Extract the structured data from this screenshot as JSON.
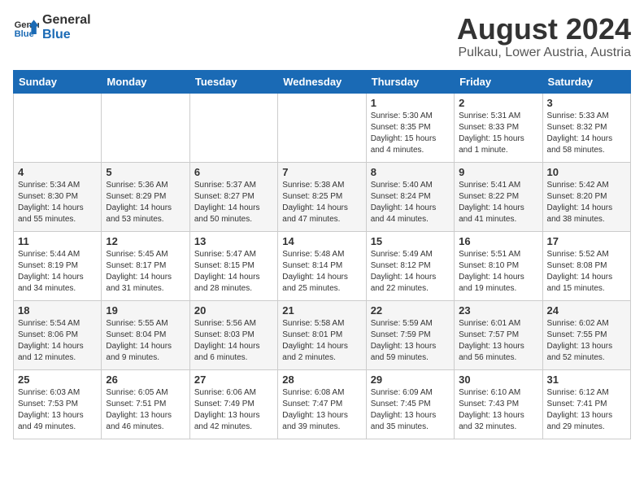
{
  "logo": {
    "line1": "General",
    "line2": "Blue"
  },
  "title": "August 2024",
  "subtitle": "Pulkau, Lower Austria, Austria",
  "days_of_week": [
    "Sunday",
    "Monday",
    "Tuesday",
    "Wednesday",
    "Thursday",
    "Friday",
    "Saturday"
  ],
  "weeks": [
    [
      {
        "day": "",
        "info": ""
      },
      {
        "day": "",
        "info": ""
      },
      {
        "day": "",
        "info": ""
      },
      {
        "day": "",
        "info": ""
      },
      {
        "day": "1",
        "info": "Sunrise: 5:30 AM\nSunset: 8:35 PM\nDaylight: 15 hours and 4 minutes."
      },
      {
        "day": "2",
        "info": "Sunrise: 5:31 AM\nSunset: 8:33 PM\nDaylight: 15 hours and 1 minute."
      },
      {
        "day": "3",
        "info": "Sunrise: 5:33 AM\nSunset: 8:32 PM\nDaylight: 14 hours and 58 minutes."
      }
    ],
    [
      {
        "day": "4",
        "info": "Sunrise: 5:34 AM\nSunset: 8:30 PM\nDaylight: 14 hours and 55 minutes."
      },
      {
        "day": "5",
        "info": "Sunrise: 5:36 AM\nSunset: 8:29 PM\nDaylight: 14 hours and 53 minutes."
      },
      {
        "day": "6",
        "info": "Sunrise: 5:37 AM\nSunset: 8:27 PM\nDaylight: 14 hours and 50 minutes."
      },
      {
        "day": "7",
        "info": "Sunrise: 5:38 AM\nSunset: 8:25 PM\nDaylight: 14 hours and 47 minutes."
      },
      {
        "day": "8",
        "info": "Sunrise: 5:40 AM\nSunset: 8:24 PM\nDaylight: 14 hours and 44 minutes."
      },
      {
        "day": "9",
        "info": "Sunrise: 5:41 AM\nSunset: 8:22 PM\nDaylight: 14 hours and 41 minutes."
      },
      {
        "day": "10",
        "info": "Sunrise: 5:42 AM\nSunset: 8:20 PM\nDaylight: 14 hours and 38 minutes."
      }
    ],
    [
      {
        "day": "11",
        "info": "Sunrise: 5:44 AM\nSunset: 8:19 PM\nDaylight: 14 hours and 34 minutes."
      },
      {
        "day": "12",
        "info": "Sunrise: 5:45 AM\nSunset: 8:17 PM\nDaylight: 14 hours and 31 minutes."
      },
      {
        "day": "13",
        "info": "Sunrise: 5:47 AM\nSunset: 8:15 PM\nDaylight: 14 hours and 28 minutes."
      },
      {
        "day": "14",
        "info": "Sunrise: 5:48 AM\nSunset: 8:14 PM\nDaylight: 14 hours and 25 minutes."
      },
      {
        "day": "15",
        "info": "Sunrise: 5:49 AM\nSunset: 8:12 PM\nDaylight: 14 hours and 22 minutes."
      },
      {
        "day": "16",
        "info": "Sunrise: 5:51 AM\nSunset: 8:10 PM\nDaylight: 14 hours and 19 minutes."
      },
      {
        "day": "17",
        "info": "Sunrise: 5:52 AM\nSunset: 8:08 PM\nDaylight: 14 hours and 15 minutes."
      }
    ],
    [
      {
        "day": "18",
        "info": "Sunrise: 5:54 AM\nSunset: 8:06 PM\nDaylight: 14 hours and 12 minutes."
      },
      {
        "day": "19",
        "info": "Sunrise: 5:55 AM\nSunset: 8:04 PM\nDaylight: 14 hours and 9 minutes."
      },
      {
        "day": "20",
        "info": "Sunrise: 5:56 AM\nSunset: 8:03 PM\nDaylight: 14 hours and 6 minutes."
      },
      {
        "day": "21",
        "info": "Sunrise: 5:58 AM\nSunset: 8:01 PM\nDaylight: 14 hours and 2 minutes."
      },
      {
        "day": "22",
        "info": "Sunrise: 5:59 AM\nSunset: 7:59 PM\nDaylight: 13 hours and 59 minutes."
      },
      {
        "day": "23",
        "info": "Sunrise: 6:01 AM\nSunset: 7:57 PM\nDaylight: 13 hours and 56 minutes."
      },
      {
        "day": "24",
        "info": "Sunrise: 6:02 AM\nSunset: 7:55 PM\nDaylight: 13 hours and 52 minutes."
      }
    ],
    [
      {
        "day": "25",
        "info": "Sunrise: 6:03 AM\nSunset: 7:53 PM\nDaylight: 13 hours and 49 minutes."
      },
      {
        "day": "26",
        "info": "Sunrise: 6:05 AM\nSunset: 7:51 PM\nDaylight: 13 hours and 46 minutes."
      },
      {
        "day": "27",
        "info": "Sunrise: 6:06 AM\nSunset: 7:49 PM\nDaylight: 13 hours and 42 minutes."
      },
      {
        "day": "28",
        "info": "Sunrise: 6:08 AM\nSunset: 7:47 PM\nDaylight: 13 hours and 39 minutes."
      },
      {
        "day": "29",
        "info": "Sunrise: 6:09 AM\nSunset: 7:45 PM\nDaylight: 13 hours and 35 minutes."
      },
      {
        "day": "30",
        "info": "Sunrise: 6:10 AM\nSunset: 7:43 PM\nDaylight: 13 hours and 32 minutes."
      },
      {
        "day": "31",
        "info": "Sunrise: 6:12 AM\nSunset: 7:41 PM\nDaylight: 13 hours and 29 minutes."
      }
    ]
  ]
}
